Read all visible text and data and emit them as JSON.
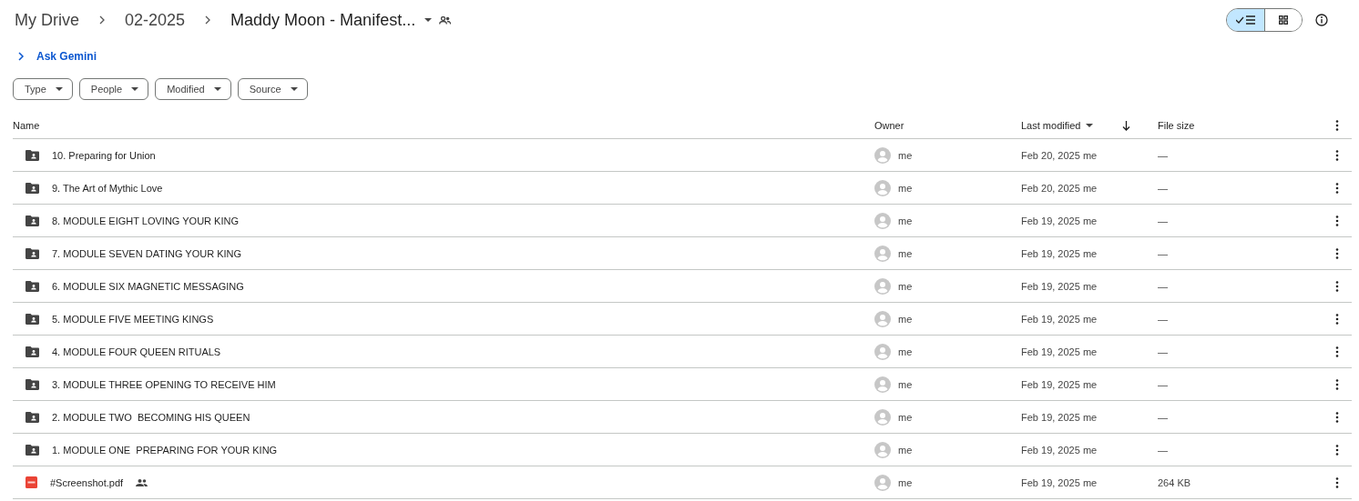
{
  "breadcrumbs": [
    {
      "label": "My Drive",
      "current": false
    },
    {
      "label": "02-2025",
      "current": false
    },
    {
      "label": "Maddy Moon - Manifest...",
      "current": true
    }
  ],
  "view_toggle": [
    {
      "kind": "list",
      "selected": true
    },
    {
      "kind": "grid",
      "selected": false
    }
  ],
  "ask_gemini": {
    "label": "Ask Gemini",
    "expanded": false
  },
  "filters": [
    "Type",
    "People",
    "Modified",
    "Source"
  ],
  "table": {
    "columns": [
      "Name",
      "Owner",
      "Last modified",
      "File size"
    ],
    "rows": [
      {
        "kind": "folder",
        "name": "10. Preparing for Union",
        "shared": false,
        "owner": "me",
        "modified": "Feb 20, 2025 me",
        "size": "—"
      },
      {
        "kind": "folder",
        "name": "9. The Art of Mythic Love",
        "shared": false,
        "owner": "me",
        "modified": "Feb 20, 2025 me",
        "size": "—"
      },
      {
        "kind": "folder",
        "name": "8. MODULE EIGHT LOVING YOUR KING",
        "shared": false,
        "owner": "me",
        "modified": "Feb 19, 2025 me",
        "size": "—"
      },
      {
        "kind": "folder",
        "name": "7. MODULE SEVEN DATING YOUR KING",
        "shared": false,
        "owner": "me",
        "modified": "Feb 19, 2025 me",
        "size": "—"
      },
      {
        "kind": "folder",
        "name": "6. MODULE SIX MAGNETIC MESSAGING",
        "shared": false,
        "owner": "me",
        "modified": "Feb 19, 2025 me",
        "size": "—"
      },
      {
        "kind": "folder",
        "name": "5. MODULE FIVE MEETING KINGS",
        "shared": false,
        "owner": "me",
        "modified": "Feb 19, 2025 me",
        "size": "—"
      },
      {
        "kind": "folder",
        "name": "4. MODULE FOUR QUEEN RITUALS",
        "shared": false,
        "owner": "me",
        "modified": "Feb 19, 2025 me",
        "size": "—"
      },
      {
        "kind": "folder",
        "name": "3. MODULE THREE OPENING TO RECEIVE HIM",
        "shared": false,
        "owner": "me",
        "modified": "Feb 19, 2025 me",
        "size": "—"
      },
      {
        "kind": "folder",
        "name": "2. MODULE TWO  BECOMING HIS QUEEN",
        "shared": false,
        "owner": "me",
        "modified": "Feb 19, 2025 me",
        "size": "—"
      },
      {
        "kind": "folder",
        "name": "1. MODULE ONE  PREPARING FOR YOUR KING",
        "shared": false,
        "owner": "me",
        "modified": "Feb 19, 2025 me",
        "size": "—"
      },
      {
        "kind": "pdf",
        "name": "#Screenshot.pdf",
        "shared": true,
        "owner": "me",
        "modified": "Feb 19, 2025 me",
        "size": "264 KB"
      }
    ]
  }
}
